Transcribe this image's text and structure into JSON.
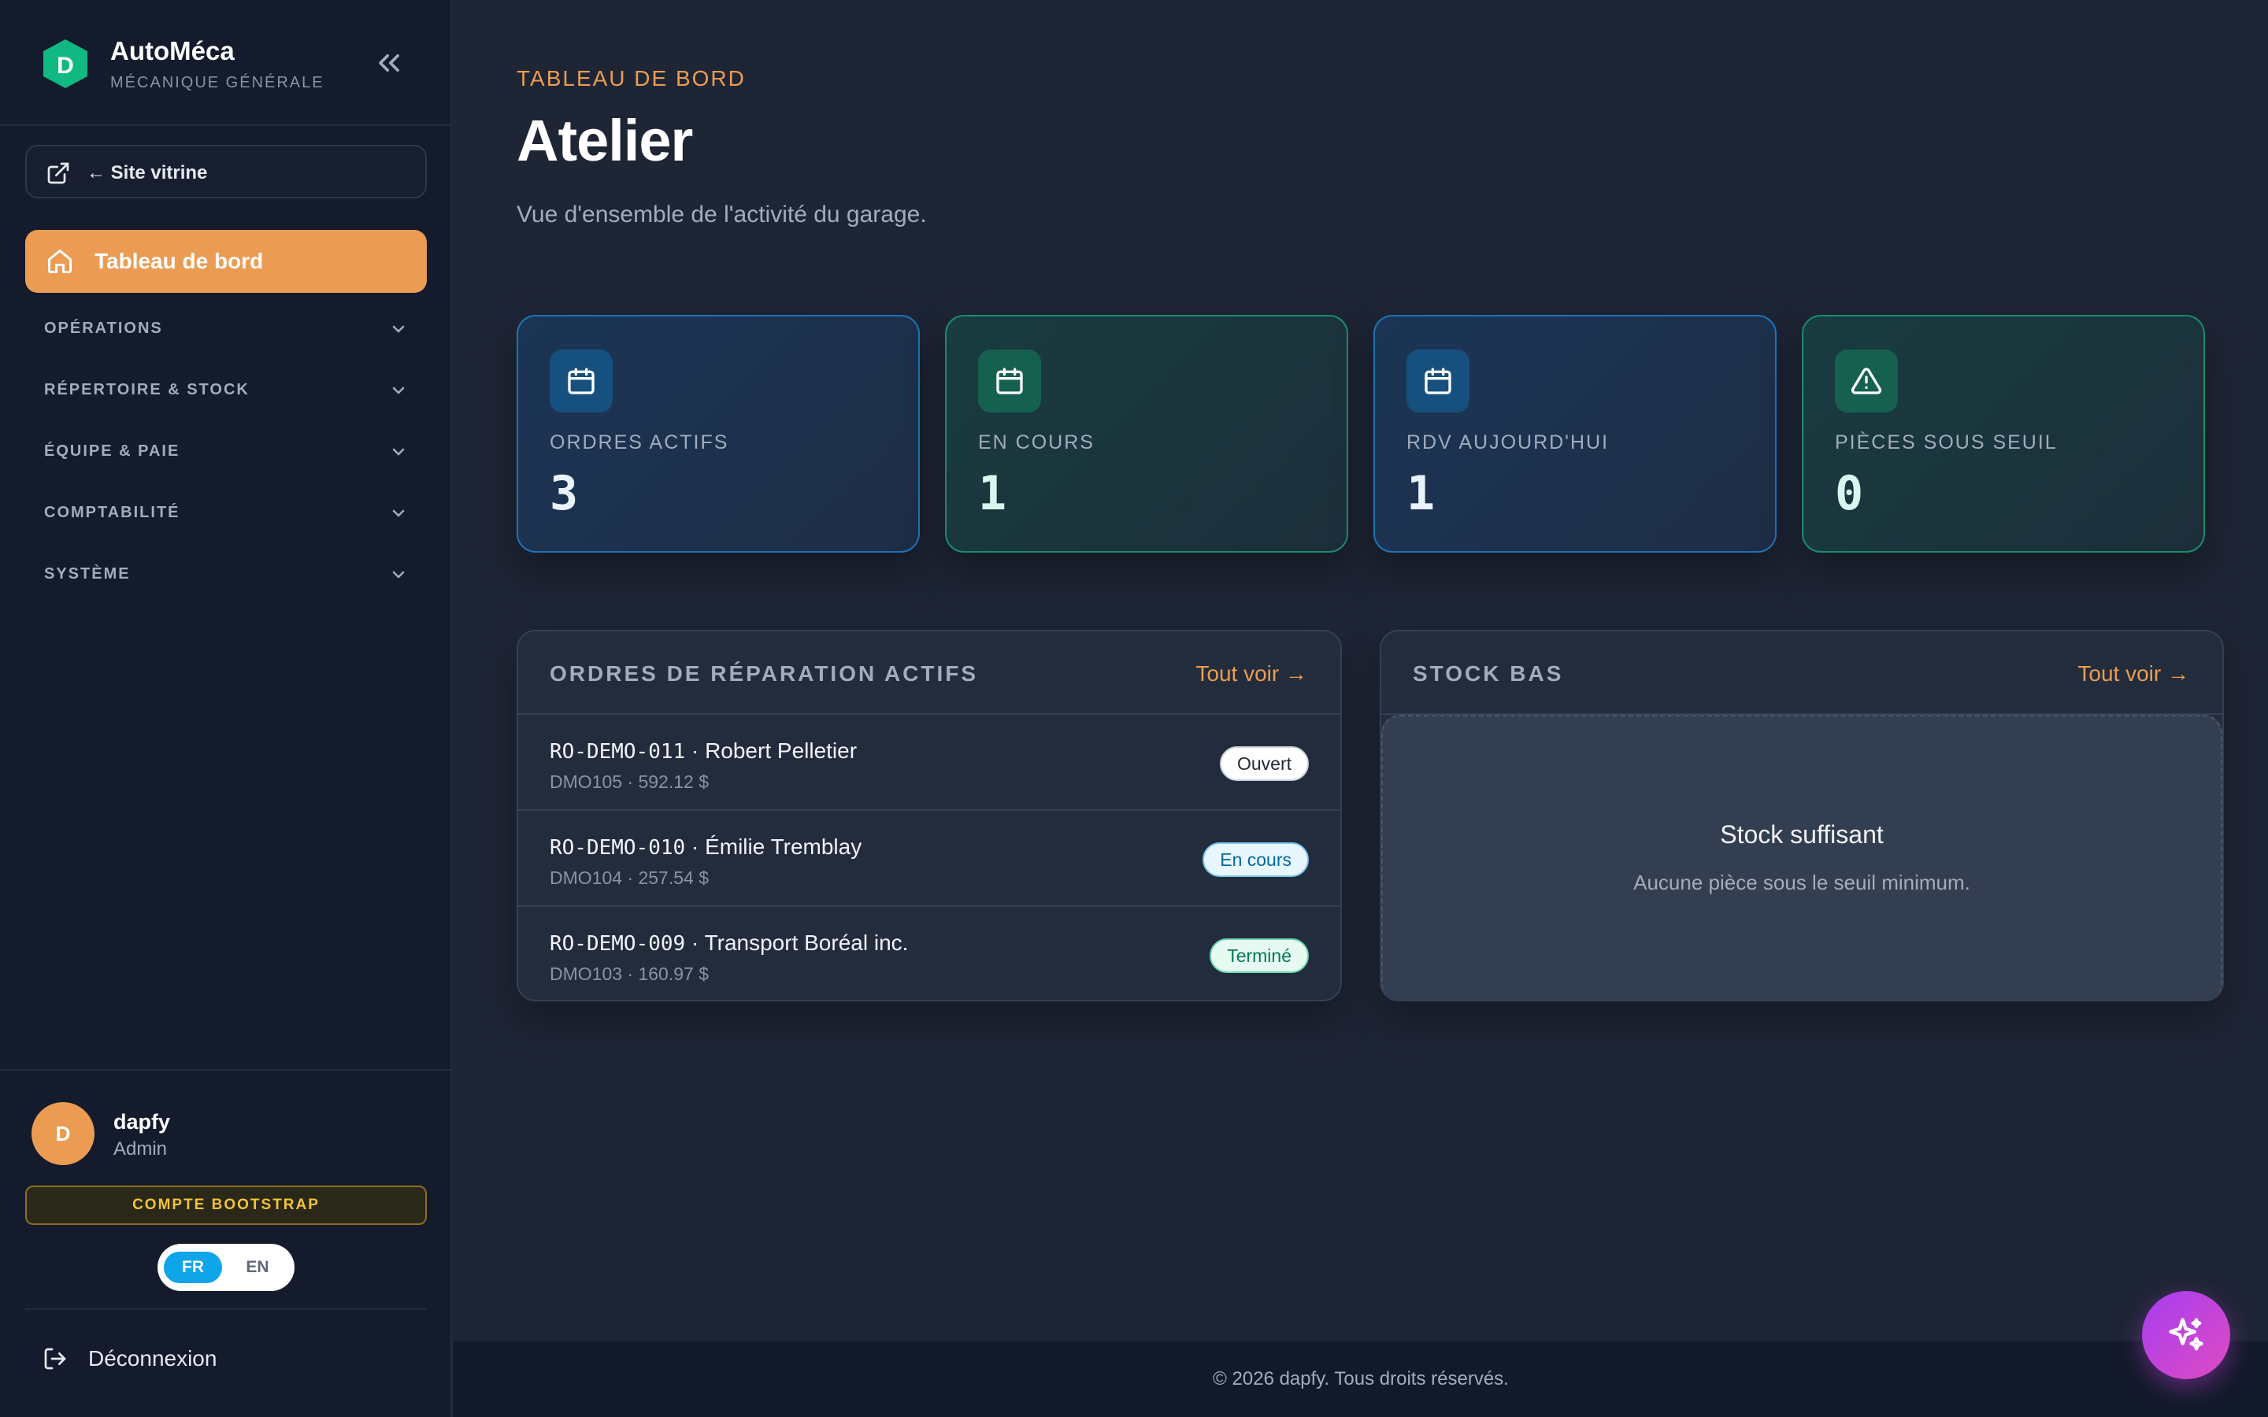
{
  "brand": {
    "name": "AutoMéca",
    "subtitle": "MÉCANIQUE GÉNÉRALE",
    "logo_letter": "D"
  },
  "sidebar": {
    "site_link": "← Site vitrine",
    "active_item": "Tableau de bord",
    "groups": [
      "OPÉRATIONS",
      "RÉPERTOIRE & STOCK",
      "ÉQUIPE & PAIE",
      "COMPTABILITÉ",
      "SYSTÈME"
    ]
  },
  "user": {
    "initial": "D",
    "name": "dapfy",
    "role": "Admin",
    "account_badge": "COMPTE BOOTSTRAP",
    "languages": [
      "FR",
      "EN"
    ],
    "selected_language": "FR",
    "logout": "Déconnexion"
  },
  "header": {
    "eyebrow": "TABLEAU DE BORD",
    "title": "Atelier",
    "subtitle": "Vue d'ensemble de l'activité du garage."
  },
  "stats": [
    {
      "label": "ORDRES ACTIFS",
      "value": "3",
      "icon": "calendar-icon",
      "tone": "blue"
    },
    {
      "label": "EN COURS",
      "value": "1",
      "icon": "calendar-icon",
      "tone": "green"
    },
    {
      "label": "RDV AUJOURD'HUI",
      "value": "1",
      "icon": "calendar-icon",
      "tone": "blue"
    },
    {
      "label": "PIÈCES SOUS SEUIL",
      "value": "0",
      "icon": "warning-triangle-icon",
      "tone": "green"
    }
  ],
  "repairs_panel": {
    "title": "ORDRES DE RÉPARATION ACTIFS",
    "link": "Tout voir →",
    "rows": [
      {
        "code": "RO-DEMO-011",
        "client": " · Robert Pelletier",
        "sub": "DMO105 · 592.12 $",
        "status": "Ouvert"
      },
      {
        "code": "RO-DEMO-010",
        "client": " · Émilie Tremblay",
        "sub": "DMO104 · 257.54 $",
        "status": "En cours"
      },
      {
        "code": "RO-DEMO-009",
        "client": " · Transport Boréal inc.",
        "sub": "DMO103 · 160.97 $",
        "status": "Terminé"
      }
    ]
  },
  "stock_panel": {
    "title": "STOCK BAS",
    "link": "Tout voir →",
    "empty_title": "Stock suffisant",
    "empty_sub": "Aucune pièce sous le seuil minimum."
  },
  "footer": {
    "text": "© 2026 dapfy. Tous droits réservés."
  },
  "colors": {
    "accent": "#eb9c52",
    "sidebar_bg": "#131b2c",
    "main_bg": "#1e2535",
    "blue_border": "#1f72b6",
    "green_border": "#1a8b6b",
    "fab": "#c044e0"
  }
}
